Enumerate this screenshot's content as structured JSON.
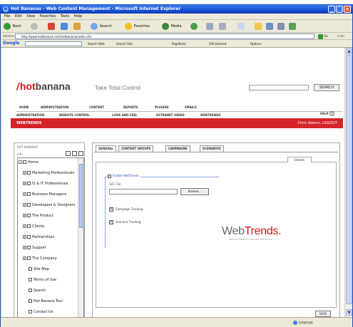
{
  "window": {
    "title": "Hot Bananas - Web Content Management - Microsoft Internet Explorer",
    "controls": [
      "_",
      "□",
      "×"
    ]
  },
  "menubar": [
    "File",
    "Edit",
    "View",
    "Favorites",
    "Tools",
    "Help"
  ],
  "toolbar": {
    "back": "Back",
    "search": "Search",
    "favorites": "Favorites",
    "media": "Media"
  },
  "address": {
    "label": "Address",
    "url": "http://www.hotbanana.com/hotbanana/index.cfm",
    "go": "Go",
    "links": "Links"
  },
  "googlebar": {
    "logo": "Google",
    "search_web": "Search Web",
    "search_site": "Search Site",
    "pagerank": "PageRank",
    "blocked": "246 blocked",
    "options": "Options"
  },
  "site": {
    "logo_hot": "hot",
    "logo_rest": "banana",
    "tagline": "Take Total Control",
    "search_button": "SEARCH",
    "nav_primary": [
      "HOME",
      "ADMINISTRATION",
      "CONTENT",
      "REPORTS",
      "PLUGINS",
      "EMAILS"
    ],
    "nav_secondary": [
      "ADMINISTRATION",
      "WEBSITE CONTROL",
      "LOOK AND FEEL",
      "EXTRANET USERS",
      "WEBTRENDS"
    ],
    "help": "HELP",
    "section_title": "WEBTRENDS",
    "user_text": "Chris Adams, LOGOUT"
  },
  "left_panel": {
    "title": "HOT BANANAS",
    "label": "Site",
    "tree": [
      {
        "label": "Home",
        "expander": "-",
        "indent": 0
      },
      {
        "label": "Marketing Professionals",
        "expander": "+",
        "indent": 1
      },
      {
        "label": "IS & IT Professionals",
        "expander": "+",
        "indent": 1
      },
      {
        "label": "Business Managers",
        "expander": "+",
        "indent": 1
      },
      {
        "label": "Developers & Designers",
        "expander": "+",
        "indent": 1
      },
      {
        "label": "The Product",
        "expander": "+",
        "indent": 1
      },
      {
        "label": "Clients",
        "expander": "+",
        "indent": 1
      },
      {
        "label": "Partnerships",
        "expander": "+",
        "indent": 1
      },
      {
        "label": "Support",
        "expander": "+",
        "indent": 1
      },
      {
        "label": "The Company",
        "expander": "+",
        "indent": 1
      },
      {
        "label": "Site Map",
        "expander": "",
        "indent": 1
      },
      {
        "label": "Terms of Use",
        "expander": "",
        "indent": 1
      },
      {
        "label": "Search",
        "expander": "",
        "indent": 1
      },
      {
        "label": "Hot Banana Tour",
        "expander": "",
        "indent": 1
      },
      {
        "label": "Contact Us",
        "expander": "",
        "indent": 1
      }
    ]
  },
  "right_panel": {
    "tabs": [
      "GENERAL",
      "CONTENT GROUPS",
      "CAMPAIGNS",
      "SCENARIOS"
    ],
    "details_tab": "Details",
    "enable_label": "Enable WebTrends",
    "ssid_label": "SDC File",
    "browse_button": "Browse...",
    "campaign_tracking": "Campaign Tracking",
    "scenario_tracking": "Scenario Tracking",
    "webtrends_logo": "WebTrends.",
    "webtrends_sub": "RELATIONSHIP BASED RESULTS",
    "save_button": "SAVE"
  },
  "statusbar": {
    "text": "",
    "zone": "Internet"
  }
}
